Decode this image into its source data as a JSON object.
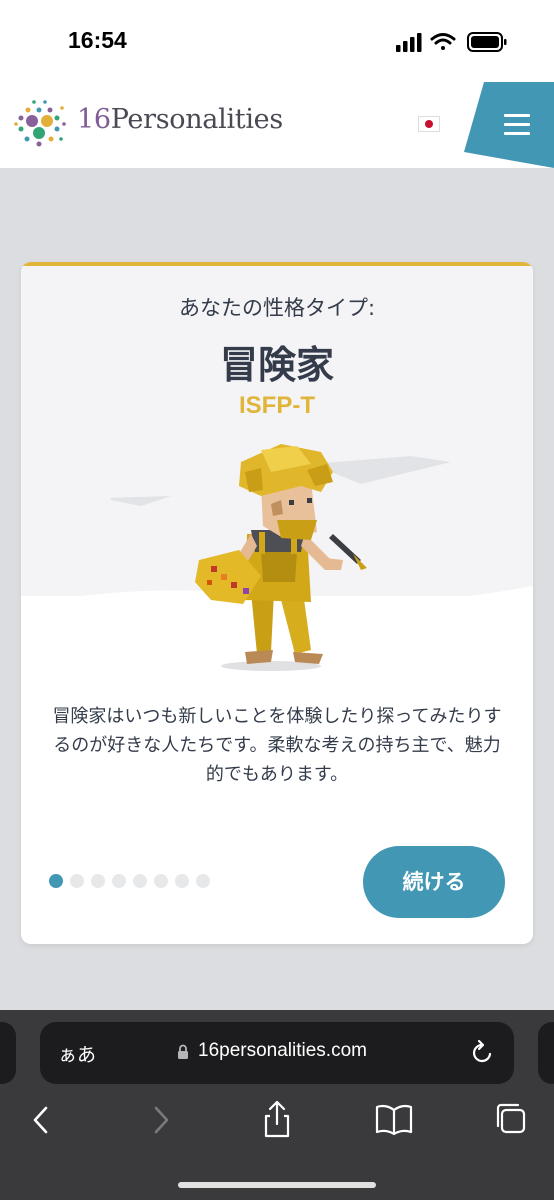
{
  "status_bar": {
    "time": "16:54"
  },
  "header": {
    "logo_number": "16",
    "logo_word": "Personalities",
    "language_flag": "japan-flag-icon",
    "menu_icon": "hamburger-menu-icon",
    "accent_color": "#4298b4"
  },
  "card": {
    "intro_label": "あなたの性格タイプ:",
    "type_name": "冒険家",
    "type_code": "ISFP-T",
    "description": "冒険家はいつも新しいことを体験したり探ってみたりするのが好きな人たちです。柔軟な考えの持ち主で、魅力的でもあります。",
    "continue_label": "続ける",
    "pager": {
      "total": 8,
      "current": 1
    },
    "accent_color": "#e1b43a"
  },
  "browser": {
    "text_size_label": "ぁあ",
    "url": "16personalities.com",
    "icons": [
      "back-icon",
      "forward-icon",
      "share-icon",
      "bookmarks-icon",
      "tabs-icon"
    ]
  }
}
